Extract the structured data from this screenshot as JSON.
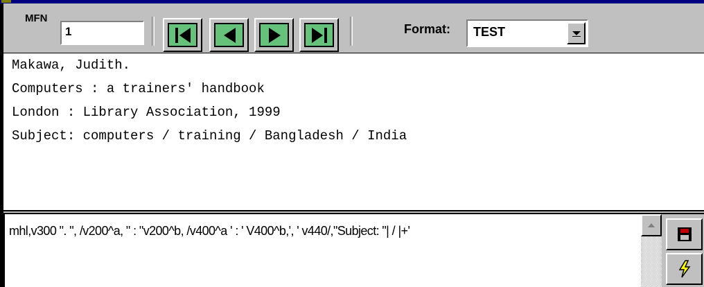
{
  "toolbar": {
    "mfn_label": "MFN",
    "mfn_value": "1",
    "format_label": "Format:",
    "format_value": "TEST"
  },
  "icons": {
    "first": "first-record-icon",
    "prev": "previous-record-icon",
    "next": "next-record-icon",
    "last": "last-record-icon",
    "dropdown": "dropdown-arrow-icon",
    "save": "save-disk-icon",
    "execute": "lightning-bolt-icon",
    "scroll_up": "scroll-up-arrow-icon"
  },
  "colors": {
    "nav_button_fill": "#66c27a",
    "title_bar": "#000080"
  },
  "display": {
    "lines": [
      "Makawa, Judith.",
      "Computers : a trainers' handbook",
      "London : Library Association, 1999",
      "Subject: computers / training / Bangladesh / India"
    ]
  },
  "editor": {
    "format_text": "mhl,v300 \". \", /v200^a, \" : \"v200^b, /v400^a ' : ' V400^b,', ' v440/,\"Subject: \"| / |+'"
  }
}
